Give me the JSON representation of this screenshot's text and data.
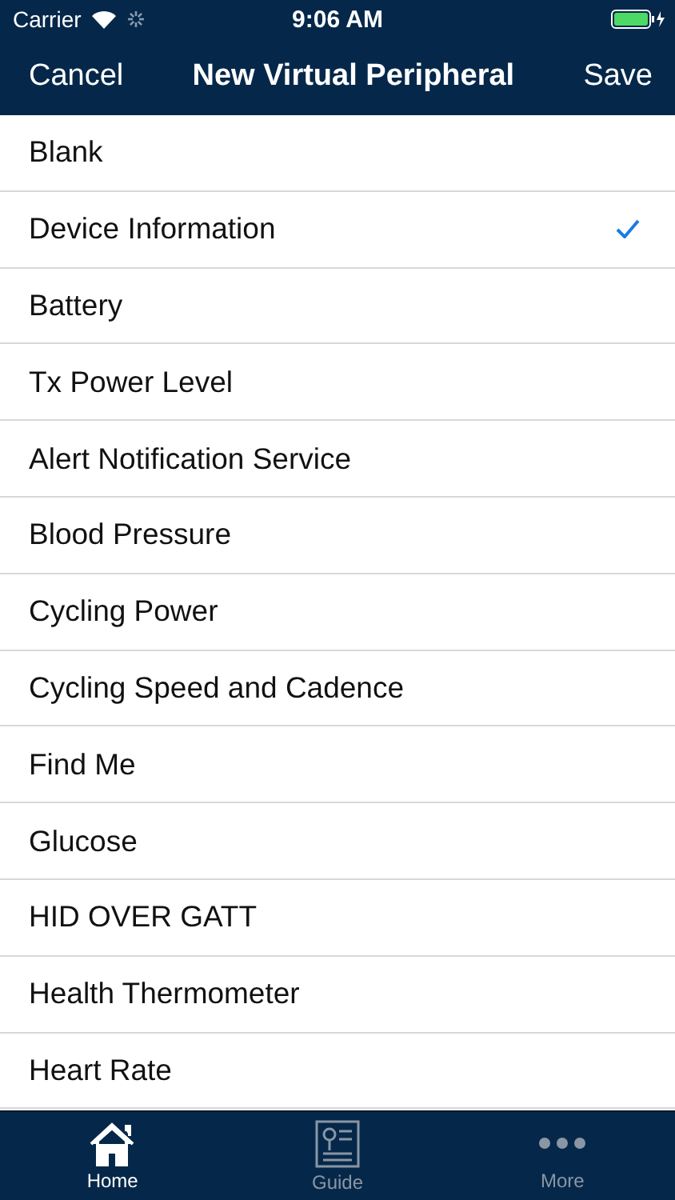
{
  "status_bar": {
    "carrier": "Carrier",
    "time": "9:06 AM"
  },
  "nav_bar": {
    "left": "Cancel",
    "title": "New Virtual Peripheral",
    "right": "Save"
  },
  "items": [
    {
      "label": "Blank",
      "selected": false
    },
    {
      "label": "Device Information",
      "selected": true
    },
    {
      "label": "Battery",
      "selected": false
    },
    {
      "label": "Tx Power Level",
      "selected": false
    },
    {
      "label": "Alert Notification Service",
      "selected": false
    },
    {
      "label": "Blood Pressure",
      "selected": false
    },
    {
      "label": "Cycling Power",
      "selected": false
    },
    {
      "label": "Cycling Speed and Cadence",
      "selected": false
    },
    {
      "label": "Find Me",
      "selected": false
    },
    {
      "label": "Glucose",
      "selected": false
    },
    {
      "label": "HID OVER GATT",
      "selected": false
    },
    {
      "label": "Health Thermometer",
      "selected": false
    },
    {
      "label": "Heart Rate",
      "selected": false
    }
  ],
  "tabs": [
    {
      "label": "Home",
      "selected": true
    },
    {
      "label": "Guide",
      "selected": false
    },
    {
      "label": "More",
      "selected": false
    }
  ]
}
